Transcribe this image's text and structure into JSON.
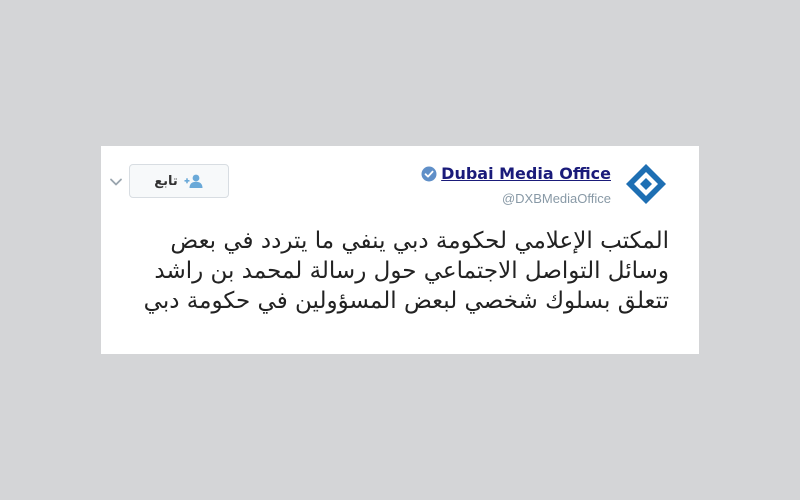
{
  "tweet": {
    "display_name": "Dubai Media Office",
    "handle": "@DXBMediaOffice",
    "follow_label": "تابع",
    "text": "المكتب الإعلامي لحكومة دبي ينفي ما يتردد في بعض وسائل التواصل الاجتماعي حول رسالة لمحمد بن راشد تتعلق بسلوك شخصي لبعض المسؤولين في حكومة دبي"
  },
  "colors": {
    "background": "#d4d5d7",
    "card": "#ffffff",
    "name": "#1a1b7a",
    "verified": "#5f8fc8",
    "logo": "#1e6fb3",
    "follow_icon": "#6aa9d8",
    "handle": "#8899a6"
  },
  "icons": {
    "logo": "diamond-logo-icon",
    "verified": "verified-badge-icon",
    "follow": "add-user-icon",
    "menu": "chevron-down-icon"
  }
}
